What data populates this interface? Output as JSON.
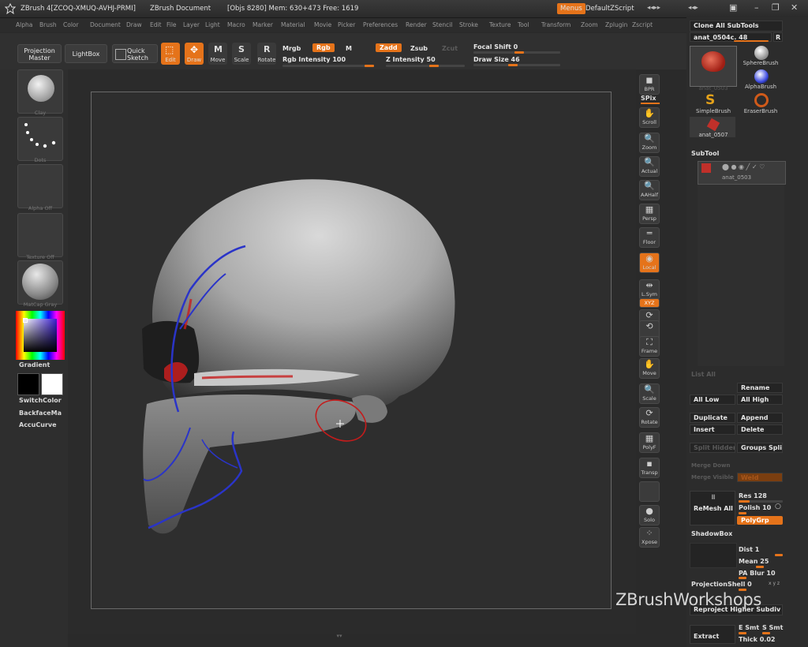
{
  "titlebar": {
    "app": "ZBrush 4[ZCOQ-XMUQ-AVHJ-PRMI]",
    "document": "ZBrush Document",
    "stats": "[Objs 8280] Mem: 630+473 Free: 1619",
    "menus_btn": "Menus",
    "script": "DefaultZScript"
  },
  "menubar": [
    "Alpha",
    "Brush",
    "Color",
    "Document",
    "Draw",
    "Edit",
    "File",
    "Layer",
    "Light",
    "Macro",
    "Marker",
    "Material",
    "Movie",
    "Picker",
    "Preferences",
    "Render",
    "Stencil",
    "Stroke",
    "Texture",
    "Tool",
    "Transform",
    "Zoom",
    "Zplugin",
    "Zscript"
  ],
  "shelf": {
    "projection_master": "Projection Master",
    "lightbox": "LightBox",
    "quick_sketch": "Quick Sketch",
    "edit": "Edit",
    "draw": "Draw",
    "move": "Move",
    "scale": "Scale",
    "rotate": "Rotate",
    "mrgb": "Mrgb",
    "rgb": "Rgb",
    "m": "M",
    "rgb_intensity": "Rgb Intensity 100",
    "zadd": "Zadd",
    "zsub": "Zsub",
    "zcut": "Zcut",
    "z_intensity": "Z Intensity 50",
    "focal_shift": "Focal Shift 0",
    "draw_size": "Draw Size 46"
  },
  "left_tray": {
    "thumbs": [
      "Clay",
      "Dots",
      "Alpha Off",
      "Texture Off",
      "MatCap Gray"
    ],
    "gradient": "Gradient",
    "switch_color": "SwitchColor",
    "backface": "BackfaceMa",
    "accucurve": "AccuCurve"
  },
  "right_strip": [
    {
      "glyph": "◼",
      "label": "BPR"
    },
    {
      "glyph": "",
      "label": "SPix"
    },
    {
      "glyph": "✋",
      "label": "Scroll"
    },
    {
      "glyph": "🔍",
      "label": "Zoom"
    },
    {
      "glyph": "🔍",
      "label": "Actual"
    },
    {
      "glyph": "🔍",
      "label": "AAHalf"
    },
    {
      "glyph": "▦",
      "label": "Persp"
    },
    {
      "glyph": "═",
      "label": "Floor"
    },
    {
      "glyph": "◉",
      "label": "Local"
    },
    {
      "glyph": "⇹",
      "label": "L.Sym"
    },
    {
      "glyph": "",
      "label": "XYZ"
    },
    {
      "glyph": "⟳",
      "label": ""
    },
    {
      "glyph": "⟲",
      "label": ""
    },
    {
      "glyph": "⛶",
      "label": "Frame"
    },
    {
      "glyph": "✋",
      "label": "Move"
    },
    {
      "glyph": "🔍",
      "label": "Scale"
    },
    {
      "glyph": "⟳",
      "label": "Rotate"
    },
    {
      "glyph": "▦",
      "label": "PolyF"
    },
    {
      "glyph": "▪",
      "label": "Transp"
    },
    {
      "glyph": "",
      "label": ""
    },
    {
      "glyph": "●",
      "label": "Solo"
    },
    {
      "glyph": "⁘",
      "label": "Xpose"
    }
  ],
  "right_panel": {
    "clone_all": "Clone All SubTools",
    "tool_name": "anat_0504c. 48",
    "r": "R",
    "brushes": [
      "anat_0503",
      "SphereBrush",
      "AlphaBrush",
      "SimpleBrush",
      "EraserBrush",
      "anat_0507"
    ],
    "subtool_header": "SubTool",
    "subtool_active": "anat_0503",
    "list_all": "List All",
    "rename": "Rename",
    "all_low": "All Low",
    "all_high": "All High",
    "duplicate": "Duplicate",
    "append": "Append",
    "insert": "Insert",
    "delete": "Delete",
    "split_hidden": "Split Hidden",
    "groups_split": "Groups Split",
    "merge_down": "Merge Down",
    "merge_visible": "Merge Visible",
    "weld": "Weld",
    "remesh_all": "ReMesh All",
    "res": "Res 128",
    "polish": "Polish 10",
    "polygrp": "PolyGrp",
    "shadowbox": "ShadowBox",
    "dist": "Dist 1",
    "mean": "Mean 25",
    "pa_blur": "PA Blur 10",
    "projection_shell": "ProjectionShell 0",
    "reproject": "Reproject Higher Subdiv",
    "extract": "Extract",
    "e_smt": "E Smt",
    "s_smt": "S Smt",
    "thick": "Thick 0.02"
  },
  "watermark": "ZBrushWorkshops",
  "colors": {
    "accent": "#e5731a",
    "bg": "#2a2a2a",
    "stroke_red": "#cc2020",
    "stroke_blue": "#2a34c8"
  }
}
